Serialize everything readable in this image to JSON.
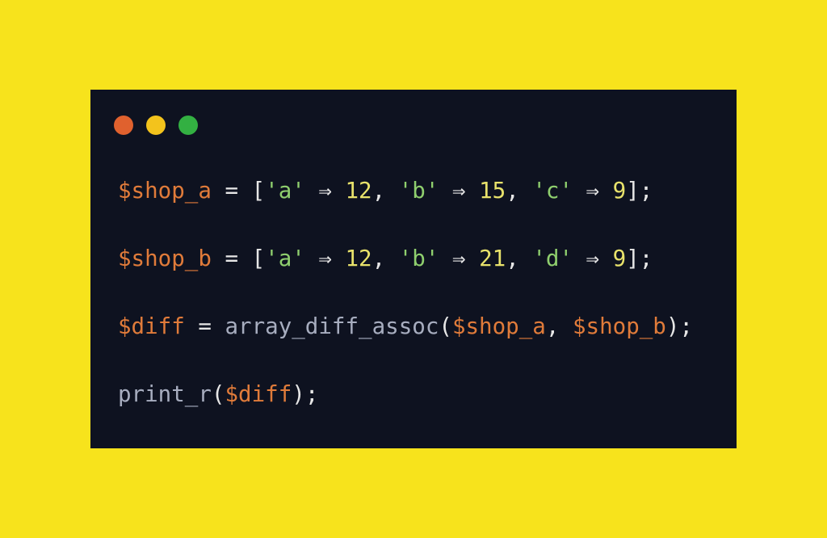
{
  "window_controls": [
    {
      "name": "close",
      "color": "#e0612e"
    },
    {
      "name": "minimize",
      "color": "#f3c31c"
    },
    {
      "name": "zoom",
      "color": "#33b042"
    }
  ],
  "colors": {
    "background": "#f7e31c",
    "window": "#0e1220",
    "variable": "#e07b3a",
    "punctuation": "#e6e6e6",
    "string": "#8fcf6e",
    "number": "#e8e26b",
    "function": "#a7adbf"
  },
  "code": [
    [
      {
        "t": "$shop_a",
        "k": "variable"
      },
      {
        "t": " = [",
        "k": "punctuation"
      },
      {
        "t": "'a'",
        "k": "string"
      },
      {
        "t": " ⇒ ",
        "k": "punctuation"
      },
      {
        "t": "12",
        "k": "number"
      },
      {
        "t": ", ",
        "k": "punctuation"
      },
      {
        "t": "'b'",
        "k": "string"
      },
      {
        "t": " ⇒ ",
        "k": "punctuation"
      },
      {
        "t": "15",
        "k": "number"
      },
      {
        "t": ", ",
        "k": "punctuation"
      },
      {
        "t": "'c'",
        "k": "string"
      },
      {
        "t": " ⇒ ",
        "k": "punctuation"
      },
      {
        "t": "9",
        "k": "number"
      },
      {
        "t": "];",
        "k": "punctuation"
      }
    ],
    [
      {
        "t": "$shop_b",
        "k": "variable"
      },
      {
        "t": " = [",
        "k": "punctuation"
      },
      {
        "t": "'a'",
        "k": "string"
      },
      {
        "t": " ⇒ ",
        "k": "punctuation"
      },
      {
        "t": "12",
        "k": "number"
      },
      {
        "t": ", ",
        "k": "punctuation"
      },
      {
        "t": "'b'",
        "k": "string"
      },
      {
        "t": " ⇒ ",
        "k": "punctuation"
      },
      {
        "t": "21",
        "k": "number"
      },
      {
        "t": ", ",
        "k": "punctuation"
      },
      {
        "t": "'d'",
        "k": "string"
      },
      {
        "t": " ⇒ ",
        "k": "punctuation"
      },
      {
        "t": "9",
        "k": "number"
      },
      {
        "t": "];",
        "k": "punctuation"
      }
    ],
    [
      {
        "t": "$diff",
        "k": "variable"
      },
      {
        "t": " = ",
        "k": "punctuation"
      },
      {
        "t": "array_diff_assoc",
        "k": "function"
      },
      {
        "t": "(",
        "k": "punctuation"
      },
      {
        "t": "$shop_a",
        "k": "variable"
      },
      {
        "t": ", ",
        "k": "punctuation"
      },
      {
        "t": "$shop_b",
        "k": "variable"
      },
      {
        "t": ");",
        "k": "punctuation"
      }
    ],
    [
      {
        "t": "print_r",
        "k": "function"
      },
      {
        "t": "(",
        "k": "punctuation"
      },
      {
        "t": "$diff",
        "k": "variable"
      },
      {
        "t": ");",
        "k": "punctuation"
      }
    ]
  ]
}
